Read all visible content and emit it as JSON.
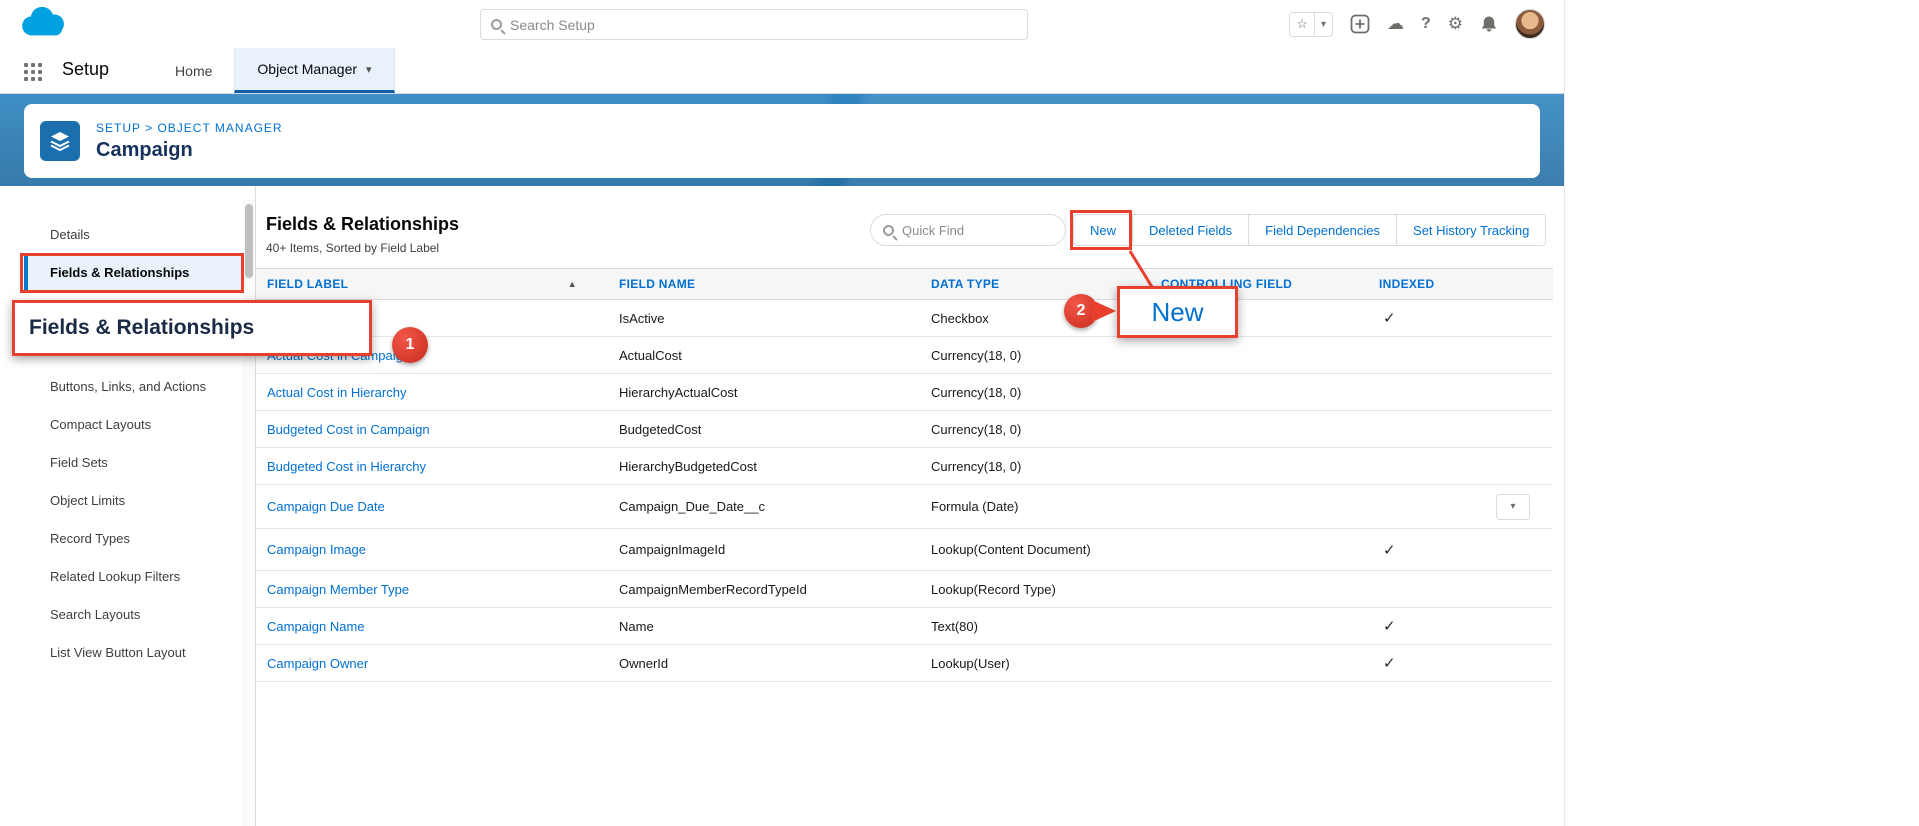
{
  "colors": {
    "accent": "#0176d3",
    "link": "#0070d2",
    "annotation_red": "#e8402d",
    "banner_blue": "#2e80ba",
    "title_navy": "#16325c"
  },
  "icons": {
    "chevron_down": "▾",
    "sort_ascending": "▲",
    "star": "☆",
    "help": "?",
    "gear": "⚙",
    "cloud": "☁"
  },
  "header": {
    "search_placeholder": "Search Setup"
  },
  "nav": {
    "app_label": "Setup",
    "tabs": [
      {
        "label": "Home"
      },
      {
        "label": "Object Manager"
      }
    ]
  },
  "banner": {
    "breadcrumb": "SETUP > OBJECT MANAGER",
    "title": "Campaign"
  },
  "sidebar": {
    "items": [
      "Details",
      "Fields & Relationships",
      "Buttons, Links, and Actions",
      "Compact Layouts",
      "Field Sets",
      "Object Limits",
      "Record Types",
      "Related Lookup Filters",
      "Search Layouts",
      "List View Button Layout"
    ]
  },
  "main": {
    "title": "Fields & Relationships",
    "subtitle": "40+ Items, Sorted by Field Label",
    "quick_find_placeholder": "Quick Find",
    "actions": [
      "New",
      "Deleted Fields",
      "Field Dependencies",
      "Set History Tracking"
    ],
    "table": {
      "columns": [
        "FIELD LABEL",
        "FIELD NAME",
        "DATA TYPE",
        "CONTROLLING FIELD",
        "INDEXED"
      ],
      "rows": [
        {
          "label": "",
          "name": "IsActive",
          "type": "Checkbox",
          "controlling": "",
          "indexed": "✓"
        },
        {
          "label": "Actual Cost in Campaign",
          "name": "ActualCost",
          "type": "Currency(18, 0)",
          "controlling": "",
          "indexed": ""
        },
        {
          "label": "Actual Cost in Hierarchy",
          "name": "HierarchyActualCost",
          "type": "Currency(18, 0)",
          "controlling": "",
          "indexed": ""
        },
        {
          "label": "Budgeted Cost in Campaign",
          "name": "BudgetedCost",
          "type": "Currency(18, 0)",
          "controlling": "",
          "indexed": ""
        },
        {
          "label": "Budgeted Cost in Hierarchy",
          "name": "HierarchyBudgetedCost",
          "type": "Currency(18, 0)",
          "controlling": "",
          "indexed": ""
        },
        {
          "label": "Campaign Due Date",
          "name": "Campaign_Due_Date__c",
          "type": "Formula (Date)",
          "controlling": "",
          "indexed": ""
        },
        {
          "label": "Campaign Image",
          "name": "CampaignImageId",
          "type": "Lookup(Content Document)",
          "controlling": "",
          "indexed": "✓"
        },
        {
          "label": "Campaign Member Type",
          "name": "CampaignMemberRecordTypeId",
          "type": "Lookup(Record Type)",
          "controlling": "",
          "indexed": ""
        },
        {
          "label": "Campaign Name",
          "name": "Name",
          "type": "Text(80)",
          "controlling": "",
          "indexed": "✓"
        },
        {
          "label": "Campaign Owner",
          "name": "OwnerId",
          "type": "Lookup(User)",
          "controlling": "",
          "indexed": "✓"
        }
      ]
    }
  },
  "annotations": {
    "step1": {
      "number": "1",
      "callout_text": "Fields & Relationships"
    },
    "step2": {
      "number": "2",
      "callout_text": "New"
    }
  }
}
